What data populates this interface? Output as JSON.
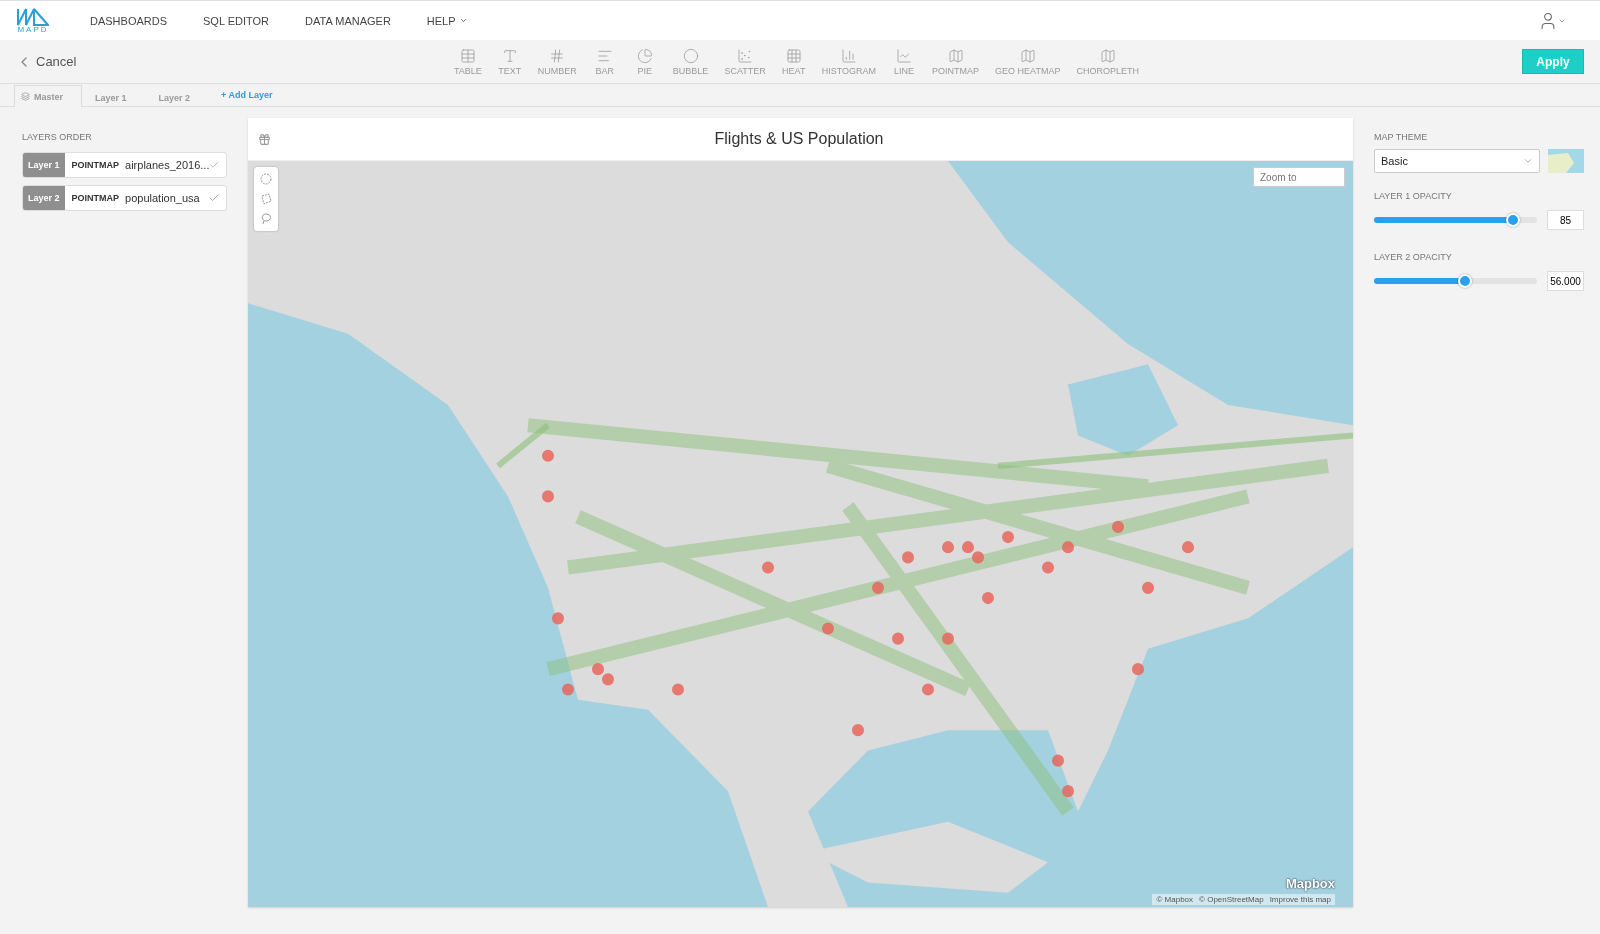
{
  "nav": {
    "logo": "MAPD",
    "items": [
      {
        "label": "DASHBOARDS",
        "dropdown": false
      },
      {
        "label": "SQL EDITOR",
        "dropdown": false
      },
      {
        "label": "DATA MANAGER",
        "dropdown": false
      },
      {
        "label": "HELP",
        "dropdown": true
      }
    ]
  },
  "toolbar": {
    "cancel": "Cancel",
    "apply": "Apply",
    "chart_types": [
      {
        "label": "TABLE",
        "kind": "table",
        "disabled": true
      },
      {
        "label": "TEXT",
        "kind": "text",
        "disabled": true
      },
      {
        "label": "NUMBER",
        "kind": "number",
        "disabled": true
      },
      {
        "label": "BAR",
        "kind": "bar",
        "disabled": true
      },
      {
        "label": "PIE",
        "kind": "pie",
        "disabled": true
      },
      {
        "label": "BUBBLE",
        "kind": "bubble",
        "disabled": true
      },
      {
        "label": "SCATTER",
        "kind": "scatter",
        "disabled": true
      },
      {
        "label": "HEAT",
        "kind": "heat",
        "disabled": true
      },
      {
        "label": "HISTOGRAM",
        "kind": "histogram",
        "disabled": true
      },
      {
        "label": "LINE",
        "kind": "line",
        "disabled": true
      },
      {
        "label": "POINTMAP",
        "kind": "map",
        "disabled": true
      },
      {
        "label": "GEO HEATMAP",
        "kind": "map",
        "disabled": true
      },
      {
        "label": "CHOROPLETH",
        "kind": "map",
        "disabled": true
      }
    ]
  },
  "tabs": [
    {
      "label": "Master",
      "selected": true,
      "icon": true
    },
    {
      "label": "Layer 1",
      "selected": false,
      "icon": false
    },
    {
      "label": "Layer 2",
      "selected": false,
      "icon": false
    }
  ],
  "add_layer": "+ Add Layer",
  "layers_order": {
    "title": "LAYERS ORDER",
    "layers": [
      {
        "badge": "Layer 1",
        "type": "POINTMAP",
        "name": "airplanes_2016..."
      },
      {
        "badge": "Layer 2",
        "type": "POINTMAP",
        "name": "population_usa"
      }
    ]
  },
  "chart": {
    "title": "Flights & US Population",
    "map": {
      "kind": "picture",
      "zoom_placeholder": "Zoom to",
      "logo": "Mapbox",
      "attribution": [
        "© Mapbox",
        "© OpenStreetMap",
        "Improve this map"
      ]
    }
  },
  "settings": {
    "theme_label": "MAP THEME",
    "theme_value": "Basic",
    "sliders": [
      {
        "label": "LAYER 1 OPACITY",
        "level": 0.85,
        "value": "85"
      },
      {
        "label": "LAYER 2 OPACITY",
        "level": 0.56,
        "value": "56.000"
      }
    ]
  }
}
